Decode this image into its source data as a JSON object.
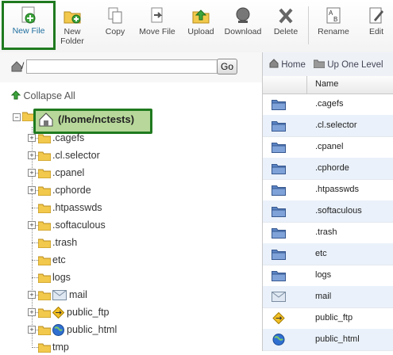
{
  "toolbar": {
    "new_file": "New File",
    "new_folder_1": "New",
    "new_folder_2": "Folder",
    "copy": "Copy",
    "move_file": "Move File",
    "upload": "Upload",
    "download": "Download",
    "delete": "Delete",
    "rename": "Rename",
    "edit": "Edit"
  },
  "path": {
    "value": "",
    "go": "Go"
  },
  "tree": {
    "collapse_all": "Collapse All",
    "root": "(/home/nctests)",
    "items": [
      ".cagefs",
      ".cl.selector",
      ".cpanel",
      ".cphorde",
      ".htpasswds",
      ".softaculous",
      ".trash",
      "etc",
      "logs",
      "mail",
      "public_ftp",
      "public_html",
      "tmp"
    ]
  },
  "right": {
    "home": "Home",
    "up_one_level": "Up One Level",
    "col_name": "Name",
    "files": [
      ".cagefs",
      ".cl.selector",
      ".cpanel",
      ".cphorde",
      ".htpasswds",
      ".softaculous",
      ".trash",
      "etc",
      "logs",
      "mail",
      "public_ftp",
      "public_html"
    ]
  },
  "colors": {
    "highlight": "#1f7a1f",
    "folder": "#e8c55a",
    "row_alt": "#eaf1fa"
  }
}
